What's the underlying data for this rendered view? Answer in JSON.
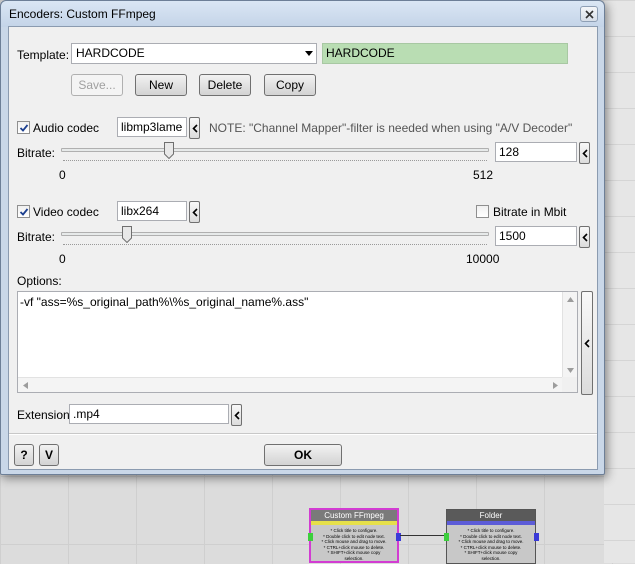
{
  "window": {
    "title": "Encoders: Custom FFmpeg"
  },
  "template": {
    "label": "Template:",
    "selected": "HARDCODE",
    "name_value": "HARDCODE"
  },
  "buttons": {
    "save": "Save...",
    "new": "New",
    "delete": "Delete",
    "copy": "Copy"
  },
  "audio": {
    "checkbox_label": "Audio codec",
    "checked": true,
    "codec": "libmp3lame",
    "note": "NOTE: \"Channel Mapper\"-filter is needed when using \"A/V Decoder\"",
    "bitrate_label": "Bitrate:",
    "bitrate_value": "128",
    "min": "0",
    "max": "512",
    "bitrate_numeric": 128
  },
  "video": {
    "checkbox_label": "Video codec",
    "checked": true,
    "codec": "libx264",
    "mbit_label": "Bitrate in Mbit",
    "mbit_checked": false,
    "bitrate_label": "Bitrate:",
    "bitrate_value": "1500",
    "min": "0",
    "max": "10000",
    "bitrate_numeric": 1500
  },
  "options": {
    "label": "Options:",
    "value": "-vf \"ass=%s_original_path%\\%s_original_name%.ass\""
  },
  "extension": {
    "label": "Extension:",
    "value": ".mp4"
  },
  "footer": {
    "help": "?",
    "v": "V",
    "ok": "OK"
  },
  "background_nodes": [
    {
      "title": "Custom FFmpeg",
      "lines": [
        "* Click title to configure.",
        "* Double click to edit node text.",
        "* Click mouse and drag to move.",
        "* CTRL+click mouse to delete.",
        "* SHIFT+click mouse copy",
        "selection."
      ]
    },
    {
      "title": "Folder",
      "lines": [
        "* Click title to configure.",
        "* Double click to edit node text.",
        "* Click mouse and drag to move.",
        "* CTRL+click mouse to delete.",
        "* SHIFT+click mouse copy",
        "selection."
      ]
    }
  ],
  "colors": {
    "template_name_bg": "#b9ddb3",
    "node1_border": "#d23cd2",
    "node1_title": "#7a7a7a",
    "node1_bar": "#e6e04a",
    "node2_title": "#5a5a5a",
    "node2_bar": "#5c5cd8"
  }
}
